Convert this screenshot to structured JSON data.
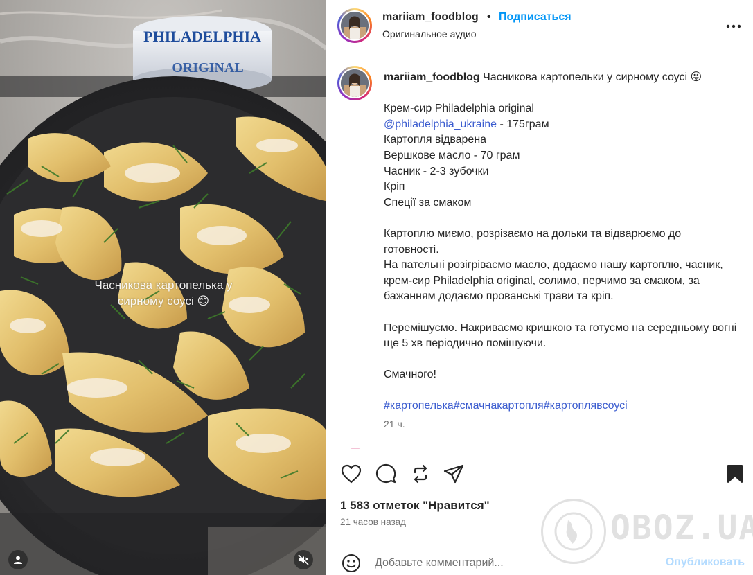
{
  "media": {
    "overlay_line1": "Часникова картопелька у",
    "overlay_line2": "сирному соусі 😊",
    "jar_brand": "PHILADELPHIA",
    "jar_sub": "ORIGINAL"
  },
  "header": {
    "username": "mariiam_foodblog",
    "dot": "•",
    "follow_label": "Подписаться",
    "audio_label": "Оригинальное аудио"
  },
  "caption": {
    "username": "mariiam_foodblog",
    "title": " Часникова картопельки у сирному соусі 😜",
    "line_ingredients_1": "Крем-сир Philadelphia original",
    "mention": "@philadelphia_ukraine",
    "mention_suffix": " - 175грам",
    "lines_ingredients": "Картопля відварена\nВершкове масло - 70 грам\nЧасник - 2-3 зубочки\nКріп\nСпеції за смаком",
    "paragraph_1": "Картоплю миємо, розрізаємо на дольки та відварюємо до готовності.\nНа пательні розігріваємо масло, додаємо нашу картоплю, часник, крем-сир Philadelphia original, солимо, перчимо за смаком, за бажанням додаємо прованські трави та кріп.",
    "paragraph_2": "Перемішуємо. Накриваємо кришкою та готуємо на середньому вогні ще 5 хв періодично помішуючи.",
    "paragraph_3": "Смачного!",
    "hashtags": "#картопелька#смачнакартопля#картоплявсоусі",
    "time": "21 ч."
  },
  "stats": {
    "likes": "1 583 отметок \"Нравится\"",
    "posted_ago": "21 часов назад"
  },
  "comment": {
    "placeholder": "Добавьте комментарий...",
    "publish_label": "Опубликовать"
  },
  "watermark": {
    "text": "OBOZ.UA"
  },
  "icons": {
    "like": "heart-icon",
    "comment": "comment-icon",
    "repost": "repost-icon",
    "share": "share-icon",
    "save": "bookmark-icon",
    "more": "more-icon",
    "emoji": "emoji-icon",
    "mute": "muted-speaker-icon",
    "user": "user-icon"
  },
  "colors": {
    "accent": "#0095f6",
    "link": "#3b5ccf",
    "muted": "#737373",
    "publish_disabled": "#b3dbff"
  }
}
